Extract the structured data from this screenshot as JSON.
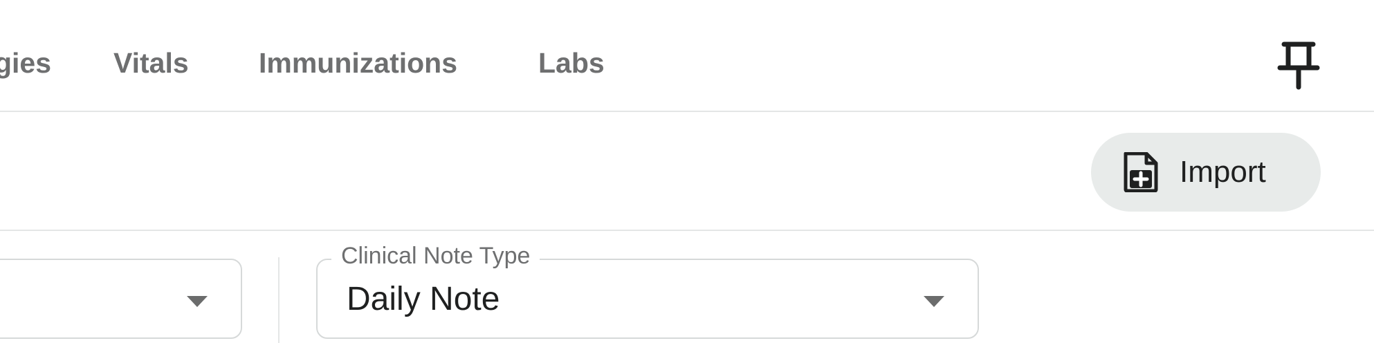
{
  "tabs": [
    {
      "label": "gies"
    },
    {
      "label": "Vitals"
    },
    {
      "label": "Immunizations"
    },
    {
      "label": "Labs"
    }
  ],
  "header": {
    "pin_icon": "pin-icon"
  },
  "toolbar": {
    "import_label": "Import",
    "import_icon": "file-plus-icon"
  },
  "filters": {
    "note_type": {
      "label": "Clinical Note Type",
      "value": "Daily Note"
    }
  },
  "colors": {
    "tab_text": "#6e6f70",
    "import_bg": "#e8ebea",
    "border": "#d6d9d9"
  }
}
